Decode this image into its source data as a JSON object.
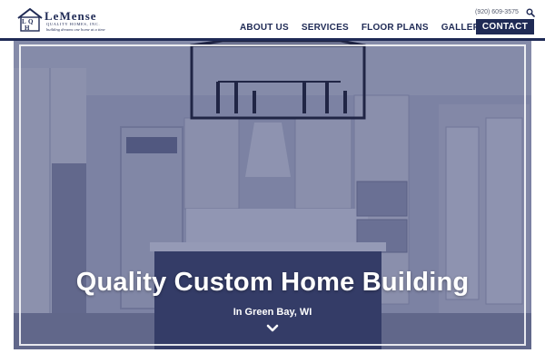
{
  "brand": {
    "name": "LeMense",
    "subtitle": "QUALITY HOMES, INC.",
    "tagline": "building dreams one home at a time",
    "monogram": "LQH",
    "color_primary": "#1f2a55"
  },
  "header": {
    "phone": "(920) 609-3575",
    "search_icon": "search-icon"
  },
  "nav": {
    "items": [
      "ABOUT US",
      "SERVICES",
      "FLOOR PLANS",
      "GALLERY"
    ],
    "contact": "CONTACT"
  },
  "hero": {
    "title": "Quality Custom Home Building",
    "subtitle": "In Green Bay, WI",
    "scroll_icon": "chevron-down-icon",
    "overlay_color": "#28326980"
  }
}
